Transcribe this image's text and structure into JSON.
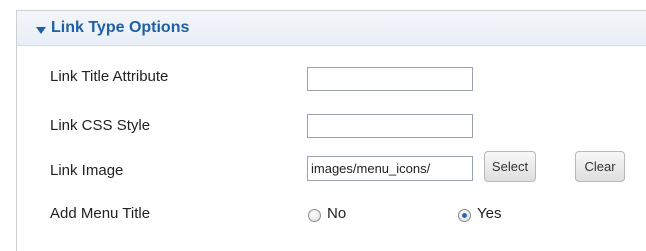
{
  "panel": {
    "title": "Link Type Options"
  },
  "fields": [
    {
      "label": "Link Title Attribute",
      "value": ""
    },
    {
      "label": "Link CSS Style",
      "value": ""
    },
    {
      "label": "Link Image",
      "value": "images/menu_icons/"
    },
    {
      "label": "Add Menu Title"
    }
  ],
  "buttons": {
    "select": "Select",
    "clear": "Clear"
  },
  "radios": {
    "no": "No",
    "yes": "Yes",
    "selected": "Yes"
  },
  "colors": {
    "accent": "#1f5fa6",
    "header_bg": "#eef3f9",
    "radio_selected": "#2b66b5"
  },
  "icons": {
    "toggle": "triangle-down-icon"
  }
}
